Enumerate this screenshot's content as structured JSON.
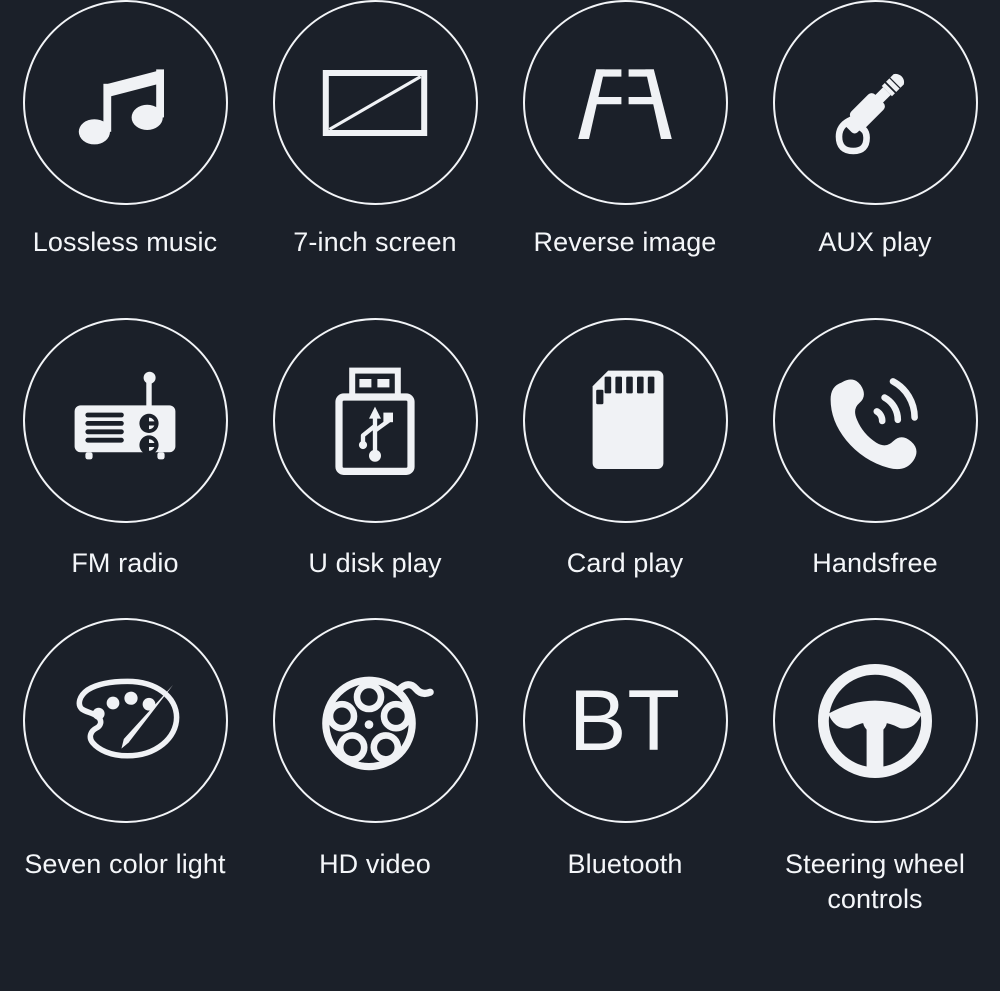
{
  "page": {
    "background_color": "#1b2029",
    "foreground_color": "#f2f4f7",
    "columns": 4,
    "rows": 3
  },
  "features": [
    {
      "icon": "music-note-icon",
      "label": "Lossless music"
    },
    {
      "icon": "screen-icon",
      "label": "7-inch screen"
    },
    {
      "icon": "parking-lines-icon",
      "label": "Reverse image"
    },
    {
      "icon": "aux-jack-icon",
      "label": "AUX play"
    },
    {
      "icon": "radio-icon",
      "label": "FM radio"
    },
    {
      "icon": "usb-drive-icon",
      "label": "U disk play"
    },
    {
      "icon": "sd-card-icon",
      "label": "Card play"
    },
    {
      "icon": "phone-ringing-icon",
      "label": "Handsfree"
    },
    {
      "icon": "palette-icon",
      "label": "Seven color light"
    },
    {
      "icon": "film-reel-icon",
      "label": "HD video"
    },
    {
      "icon": "bt-text-icon",
      "label": "Bluetooth",
      "glyph_text": "BT"
    },
    {
      "icon": "steering-wheel-icon",
      "label": "Steering wheel\ncontrols"
    }
  ]
}
